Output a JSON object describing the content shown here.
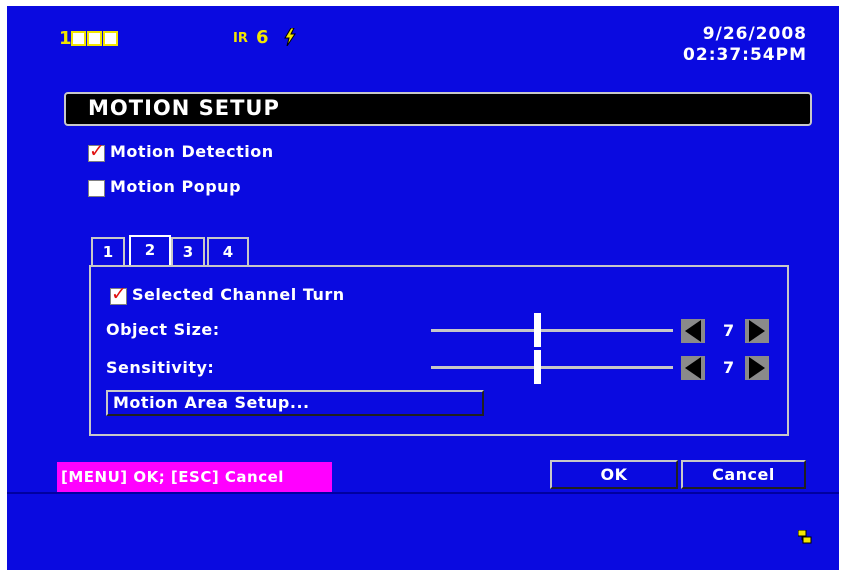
{
  "status_bar": {
    "channel_number": "1",
    "ir_label": "IR",
    "ir_value": "6",
    "date": "9/26/2008",
    "time": "02:37:54PM"
  },
  "dialog": {
    "title": "MOTION SETUP",
    "motion_detection": {
      "label": "Motion Detection",
      "checked": true
    },
    "motion_popup": {
      "label": "Motion Popup",
      "checked": false
    },
    "tabs": [
      "1",
      "2",
      "3",
      "4"
    ],
    "active_tab": "2",
    "panel": {
      "selected_channel_turn": {
        "label": "Selected Channel Turn",
        "checked": true
      },
      "object_size": {
        "label": "Object Size:",
        "value": "7",
        "level_fraction": 0.44
      },
      "sensitivity": {
        "label": "Sensitivity:",
        "value": "7",
        "level_fraction": 0.44
      },
      "motion_area_button": "Motion Area Setup..."
    },
    "hint": "[MENU] OK; [ESC] Cancel",
    "ok_label": "OK",
    "cancel_label": "Cancel"
  },
  "colors": {
    "background": "#0a0ae0",
    "highlight_text": "#f2e600",
    "hint_background": "#ff00ff",
    "check_mark": "#e01010"
  },
  "icons": [
    "flash-icon",
    "network-icon",
    "left-arrow-icon",
    "right-arrow-icon"
  ]
}
